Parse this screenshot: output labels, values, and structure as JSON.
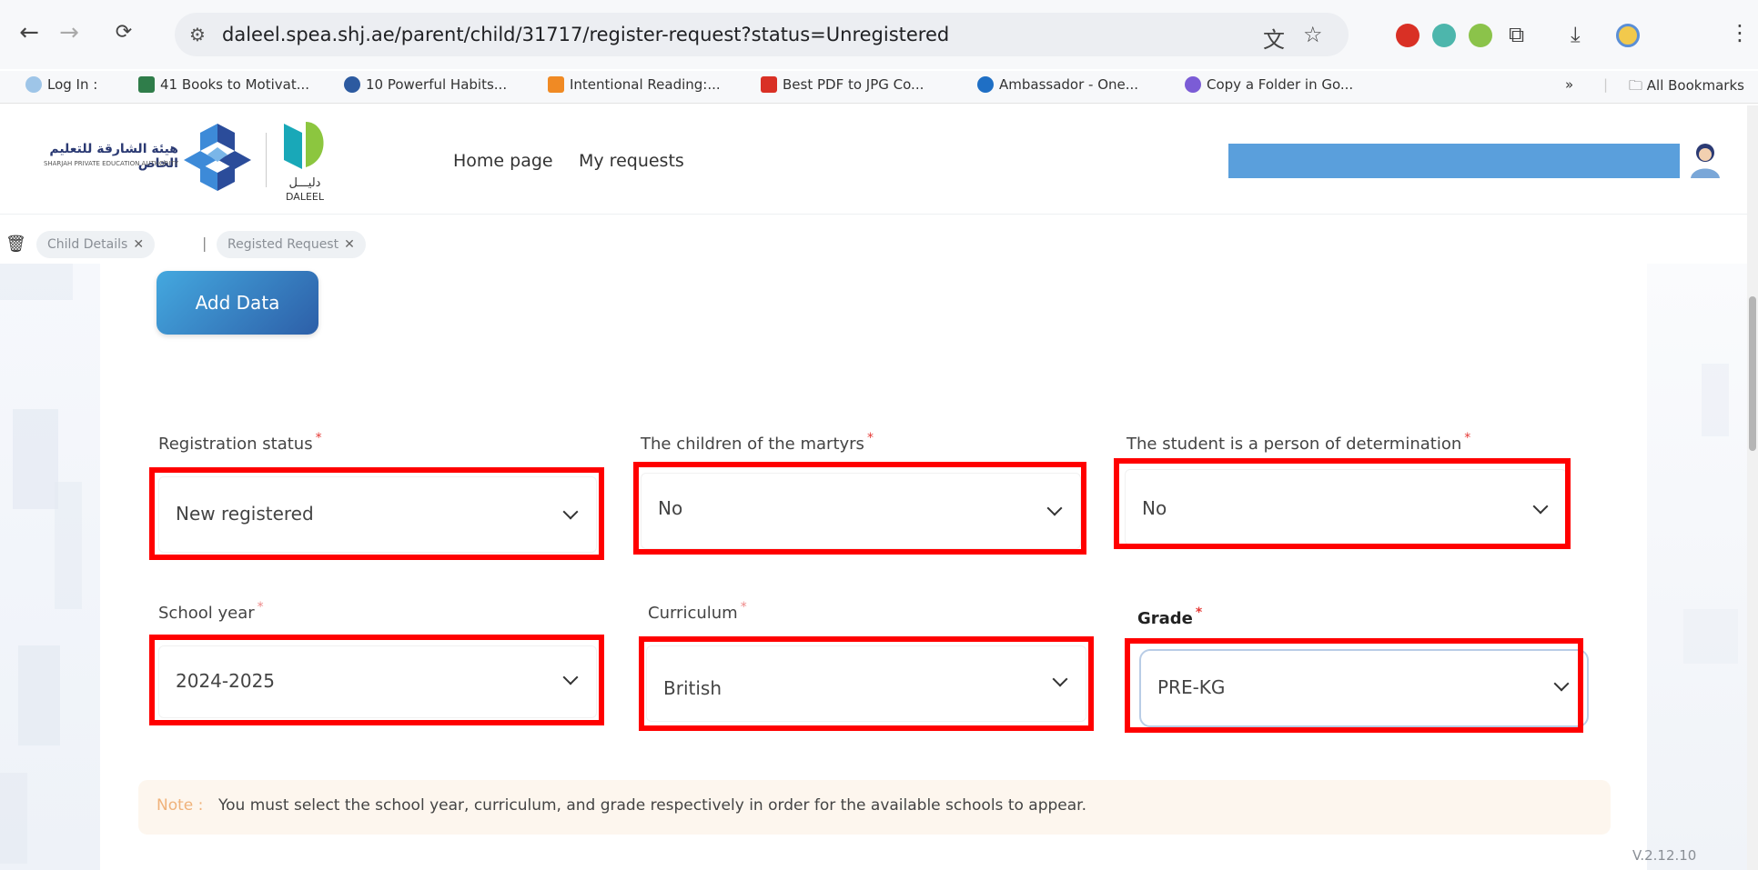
{
  "browser": {
    "url": "daleel.spea.shj.ae/parent/child/31717/register-request?status=Unregistered",
    "bookmarks": [
      {
        "label": "Log In :",
        "color": "#9ec5e8"
      },
      {
        "label": "41 Books to Motivat...",
        "color": "#2f7d4a"
      },
      {
        "label": "10 Powerful Habits...",
        "color": "#2c5aa0"
      },
      {
        "label": "Intentional Reading:...",
        "color": "#f08a24"
      },
      {
        "label": "Best PDF to JPG Co...",
        "color": "#d93025"
      },
      {
        "label": "Ambassador - One...",
        "color": "#1f6fc5"
      },
      {
        "label": "Copy a Folder in Go...",
        "color": "#7b5cd6"
      }
    ],
    "more_label": "»",
    "all_bookmarks_label": "All Bookmarks"
  },
  "header": {
    "spea_name_ar": "هيئة الشارقة للتعليم الخاص",
    "spea_name_en": "SHARJAH PRIVATE EDUCATION AUTHORITY",
    "daleel_ar": "دليـــل",
    "daleel_en": "DALEEL",
    "nav": [
      "Home page",
      "My requests"
    ]
  },
  "tabs": [
    {
      "label": "Child Details",
      "close": "✕"
    },
    {
      "label": "Registed Request",
      "close": "✕"
    }
  ],
  "tab_separator": "|",
  "form": {
    "add_button": "Add Data",
    "required_mark": "*",
    "fields": [
      {
        "label": "Registration status",
        "value": "New registered"
      },
      {
        "label": "The children of the martyrs",
        "value": "No"
      },
      {
        "label": "The student is a person of determination",
        "value": "No"
      },
      {
        "label": "School year",
        "value": "2024-2025"
      },
      {
        "label": "Curriculum",
        "value": "British"
      },
      {
        "label": "Grade",
        "value": "PRE-KG"
      }
    ],
    "note_label": "Note :",
    "note_text": "You must select the school year, curriculum, and grade respectively in order for the available schools to appear."
  },
  "version": "V.2.12.10",
  "colors": {
    "highlight": "#ff0000",
    "accent": "#2d5fa8",
    "required": "#e53935"
  }
}
